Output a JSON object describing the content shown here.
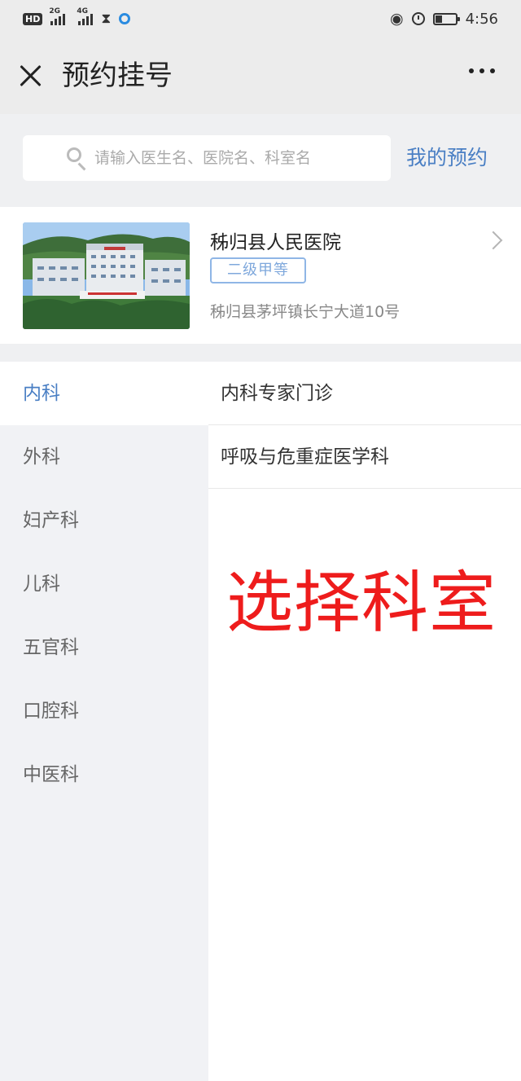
{
  "status_bar": {
    "hd_label": "HD",
    "sim1_network": "2G",
    "sim2_network": "4G",
    "time": "4:56",
    "battery_level": 0.35
  },
  "nav": {
    "title": "预约挂号"
  },
  "search": {
    "placeholder": "请输入医生名、医院名、科室名",
    "my_appointments_link": "我的预约"
  },
  "hospital": {
    "name": "秭归县人民医院",
    "level_badge": "二级甲等",
    "address": "秭归县茅坪镇长宁大道10号"
  },
  "departments": {
    "categories": [
      "内科",
      "外科",
      "妇产科",
      "儿科",
      "五官科",
      "口腔科",
      "中医科"
    ],
    "selected_index": 0,
    "sub_departments": [
      "内科专家门诊",
      "呼吸与危重症医学科"
    ]
  },
  "annotation": "选择科室",
  "colors": {
    "accent": "#4a7fc4",
    "annotation": "#ee1c1c",
    "sidebar_bg": "#f1f2f5"
  }
}
